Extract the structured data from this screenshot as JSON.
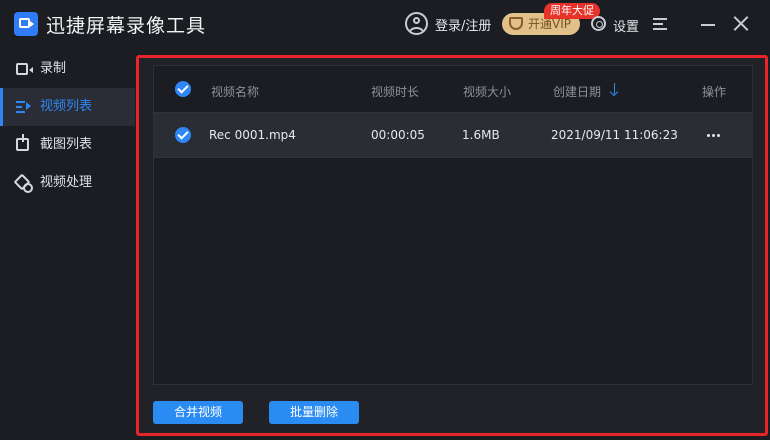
{
  "app": {
    "title": "迅捷屏幕录像工具"
  },
  "header": {
    "login_label": "登录/注册",
    "vip_label": "开通VIP",
    "promo_badge": "周年大促",
    "settings_label": "设置"
  },
  "sidebar": {
    "items": [
      {
        "label": "录制",
        "icon": "record-icon",
        "active": false
      },
      {
        "label": "视频列表",
        "icon": "video-list-icon",
        "active": true
      },
      {
        "label": "截图列表",
        "icon": "screenshot-list-icon",
        "active": false
      },
      {
        "label": "视频处理",
        "icon": "video-process-icon",
        "active": false
      }
    ]
  },
  "table": {
    "columns": [
      "视频名称",
      "视频时长",
      "视频大小",
      "创建日期",
      "操作"
    ],
    "rows": [
      {
        "checked": true,
        "name": "Rec 0001.mp4",
        "duration": "00:00:05",
        "size": "1.6MB",
        "date": "2021/09/11 11:06:23",
        "action_icon": "more-icon"
      }
    ]
  },
  "actions": {
    "merge_label": "合并视频",
    "batch_delete_label": "批量删除"
  },
  "colors": {
    "accent": "#2f86f6",
    "highlight_outline": "#e8262a",
    "vip_gold": "#e2c08a",
    "promo_red": "#e8332b"
  }
}
